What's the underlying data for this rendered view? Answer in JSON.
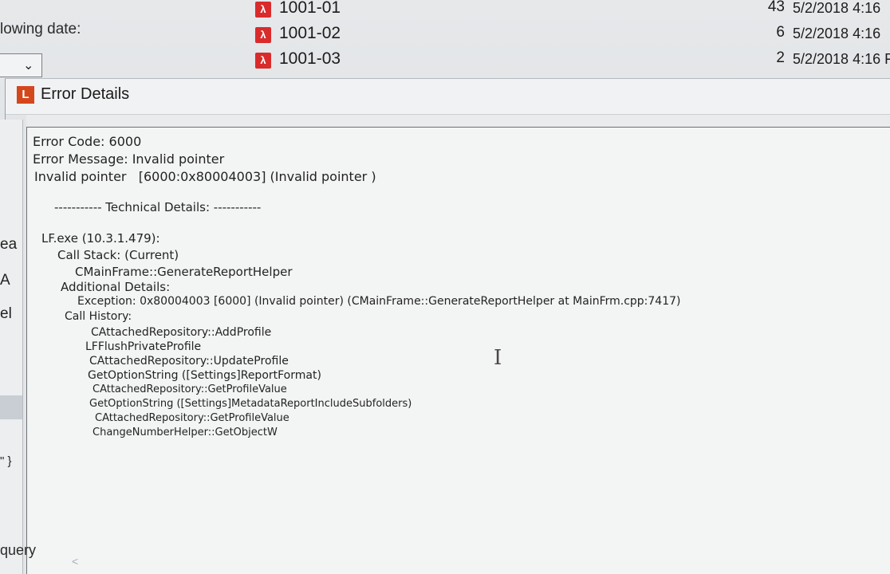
{
  "background": {
    "label_fragment": "lowing date:",
    "dropdown_chevron": "chevron-down-icon",
    "files": [
      {
        "name": "1001-01",
        "pages": "43",
        "date": "5/2/2018 4:16"
      },
      {
        "name": "1001-02",
        "pages": "6",
        "date": "5/2/2018 4:16"
      },
      {
        "name": "1001-03",
        "pages": "2",
        "date": "5/2/2018 4:16 F"
      }
    ],
    "left_fragments": [
      "ea",
      "A",
      "el",
      "\" }",
      "query"
    ]
  },
  "dialog": {
    "title": "Error Details",
    "icon_letter": "L",
    "lines": [
      "Error Code: 6000",
      "Error Message: Invalid pointer",
      "Invalid pointer   [6000:0x80004003] (Invalid pointer )",
      "----------- Technical Details: -----------",
      "LF.exe (10.3.1.479):",
      "Call Stack: (Current)",
      "CMainFrame::GenerateReportHelper",
      "Additional Details:",
      "Exception: 0x80004003 [6000] (Invalid pointer) (CMainFrame::GenerateReportHelper at MainFrm.cpp:7417)",
      "Call History:",
      "CAttachedRepository::AddProfile",
      "LFFlushPrivateProfile",
      "CAttachedRepository::UpdateProfile",
      "GetOptionString ([Settings]ReportFormat)",
      "CAttachedRepository::GetProfileValue",
      "GetOptionString ([Settings]MetadataReportIncludeSubfolders)",
      "CAttachedRepository::GetProfileValue",
      "ChangeNumberHelper::GetObjectW"
    ]
  },
  "colors": {
    "pdf_icon": "#d92b2b",
    "app_icon": "#d4471b"
  }
}
